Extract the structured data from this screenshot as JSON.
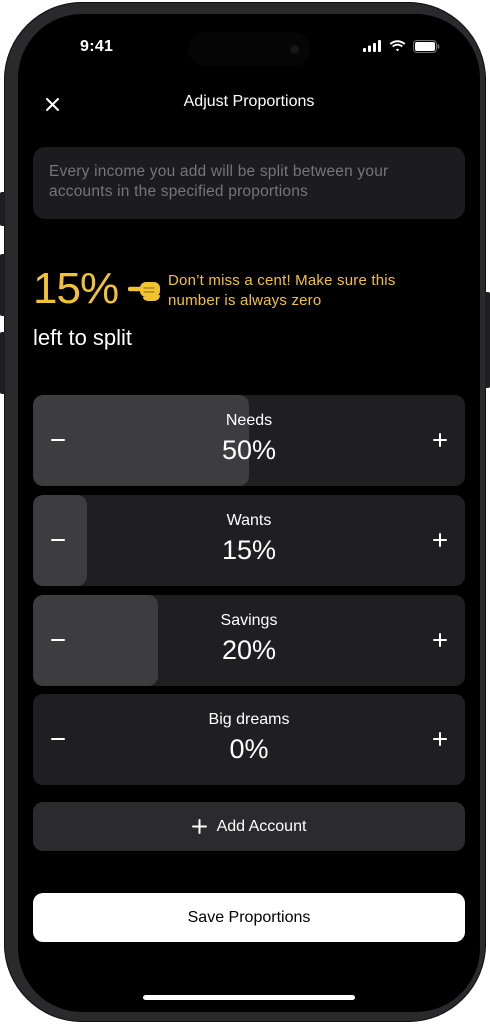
{
  "status": {
    "time": "9:41"
  },
  "nav": {
    "title": "Adjust Proportions",
    "close_icon": "close-icon"
  },
  "info": {
    "text": "Every income you add will be split between your accounts in the specified proportions"
  },
  "remaining": {
    "value": "15%",
    "label": "left to split",
    "hint": "Don’t miss a cent! Make sure this number is always zero",
    "accent": "#f2c233",
    "icon": "pointing-hand-icon"
  },
  "accounts": [
    {
      "name": "Needs",
      "value": "50%",
      "fraction": 0.5
    },
    {
      "name": "Wants",
      "value": "15%",
      "fraction": 0.125
    },
    {
      "name": "Savings",
      "value": "20%",
      "fraction": 0.29
    },
    {
      "name": "Big dreams",
      "value": "0%",
      "fraction": 0.0
    }
  ],
  "add_account": {
    "label": "Add Account"
  },
  "save": {
    "label": "Save Proportions"
  }
}
